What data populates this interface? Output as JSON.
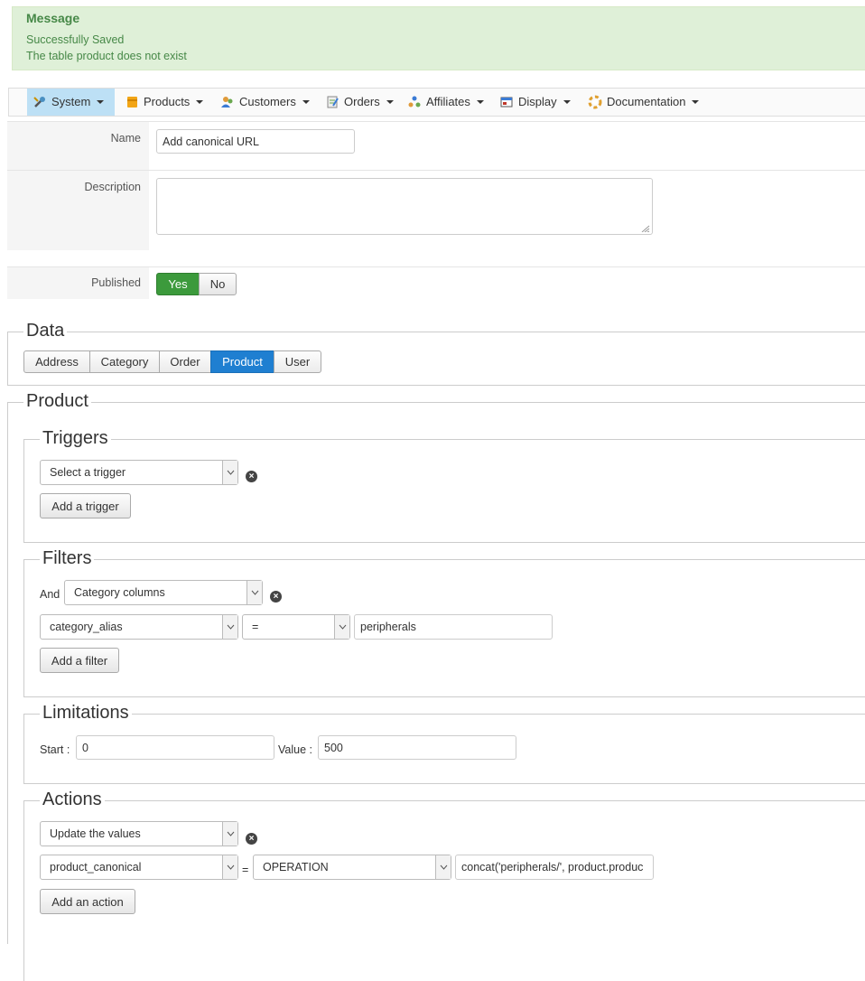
{
  "message": {
    "title": "Message",
    "lines": [
      "Successfully Saved",
      "The table product does not exist"
    ]
  },
  "menu": [
    {
      "label": "System",
      "icon": "wrench-icon",
      "active": true
    },
    {
      "label": "Products",
      "icon": "box-icon"
    },
    {
      "label": "Customers",
      "icon": "customers-icon"
    },
    {
      "label": "Orders",
      "icon": "orders-icon"
    },
    {
      "label": "Affiliates",
      "icon": "affiliates-icon"
    },
    {
      "label": "Display",
      "icon": "display-icon"
    },
    {
      "label": "Documentation",
      "icon": "lifebuoy-icon"
    }
  ],
  "form": {
    "name_label": "Name",
    "name_value": "Add canonical URL",
    "description_label": "Description",
    "description_value": "",
    "published_label": "Published",
    "published_yes": "Yes",
    "published_no": "No",
    "published_selected": "Yes"
  },
  "data_section": {
    "legend": "Data",
    "tabs": [
      "Address",
      "Category",
      "Order",
      "Product",
      "User"
    ],
    "selected": "Product"
  },
  "product_section": {
    "legend": "Product",
    "triggers": {
      "legend": "Triggers",
      "select": "Select a trigger",
      "add_button": "Add a trigger"
    },
    "filters": {
      "legend": "Filters",
      "and_label": "And",
      "group_select": "Category columns",
      "column_select": "category_alias",
      "operator_select": "=",
      "value": "peripherals",
      "add_button": "Add a filter"
    },
    "limitations": {
      "legend": "Limitations",
      "start_label": "Start :",
      "start_value": "0",
      "value_label": "Value :",
      "value_value": "500"
    },
    "actions": {
      "legend": "Actions",
      "select": "Update the values",
      "column_select": "product_canonical",
      "equals": "=",
      "operation_select": "OPERATION",
      "expression": "concat('peripherals/', product.produc",
      "add_button": "Add an action"
    }
  },
  "colors": {
    "success_bg": "#dff0d8",
    "success_text": "#468847",
    "active_tab": "#1f7fd1",
    "yes_green": "#3c9a3c",
    "menu_active": "#bde0f5"
  }
}
